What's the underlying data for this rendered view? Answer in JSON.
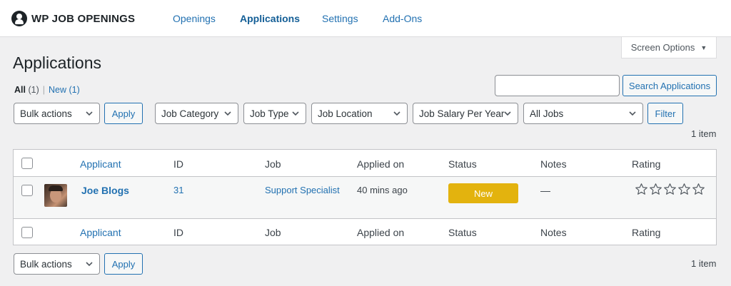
{
  "brand": {
    "name": "WP JOB OPENINGS"
  },
  "nav": [
    {
      "label": "Openings",
      "active": false
    },
    {
      "label": "Applications",
      "active": true
    },
    {
      "label": "Settings",
      "active": false
    },
    {
      "label": "Add-Ons",
      "active": false
    }
  ],
  "screen_options": {
    "label": "Screen Options"
  },
  "page": {
    "title": "Applications"
  },
  "views": {
    "all_label": "All",
    "all_count": "(1)",
    "separator": "|",
    "new_label": "New",
    "new_count": "(1)"
  },
  "search": {
    "value": "",
    "button_label": "Search Applications"
  },
  "bulk": {
    "label": "Bulk actions",
    "apply_label": "Apply"
  },
  "filters": {
    "job_category": "Job Category",
    "job_type": "Job Type",
    "job_location": "Job Location",
    "job_salary": "Job Salary Per Year",
    "all_jobs": "All Jobs",
    "filter_label": "Filter"
  },
  "item_count": "1 item",
  "table": {
    "columns": [
      "Applicant",
      "ID",
      "Job",
      "Applied on",
      "Status",
      "Notes",
      "Rating"
    ],
    "rows": [
      {
        "applicant": "Joe Blogs",
        "id": "31",
        "job": "Support Specialist",
        "applied_on": "40 mins ago",
        "status": "New",
        "notes": "—",
        "rating": 0,
        "rating_max": 5
      }
    ]
  },
  "colors": {
    "accent": "#2271b1",
    "status_new": "#e3b30e"
  }
}
